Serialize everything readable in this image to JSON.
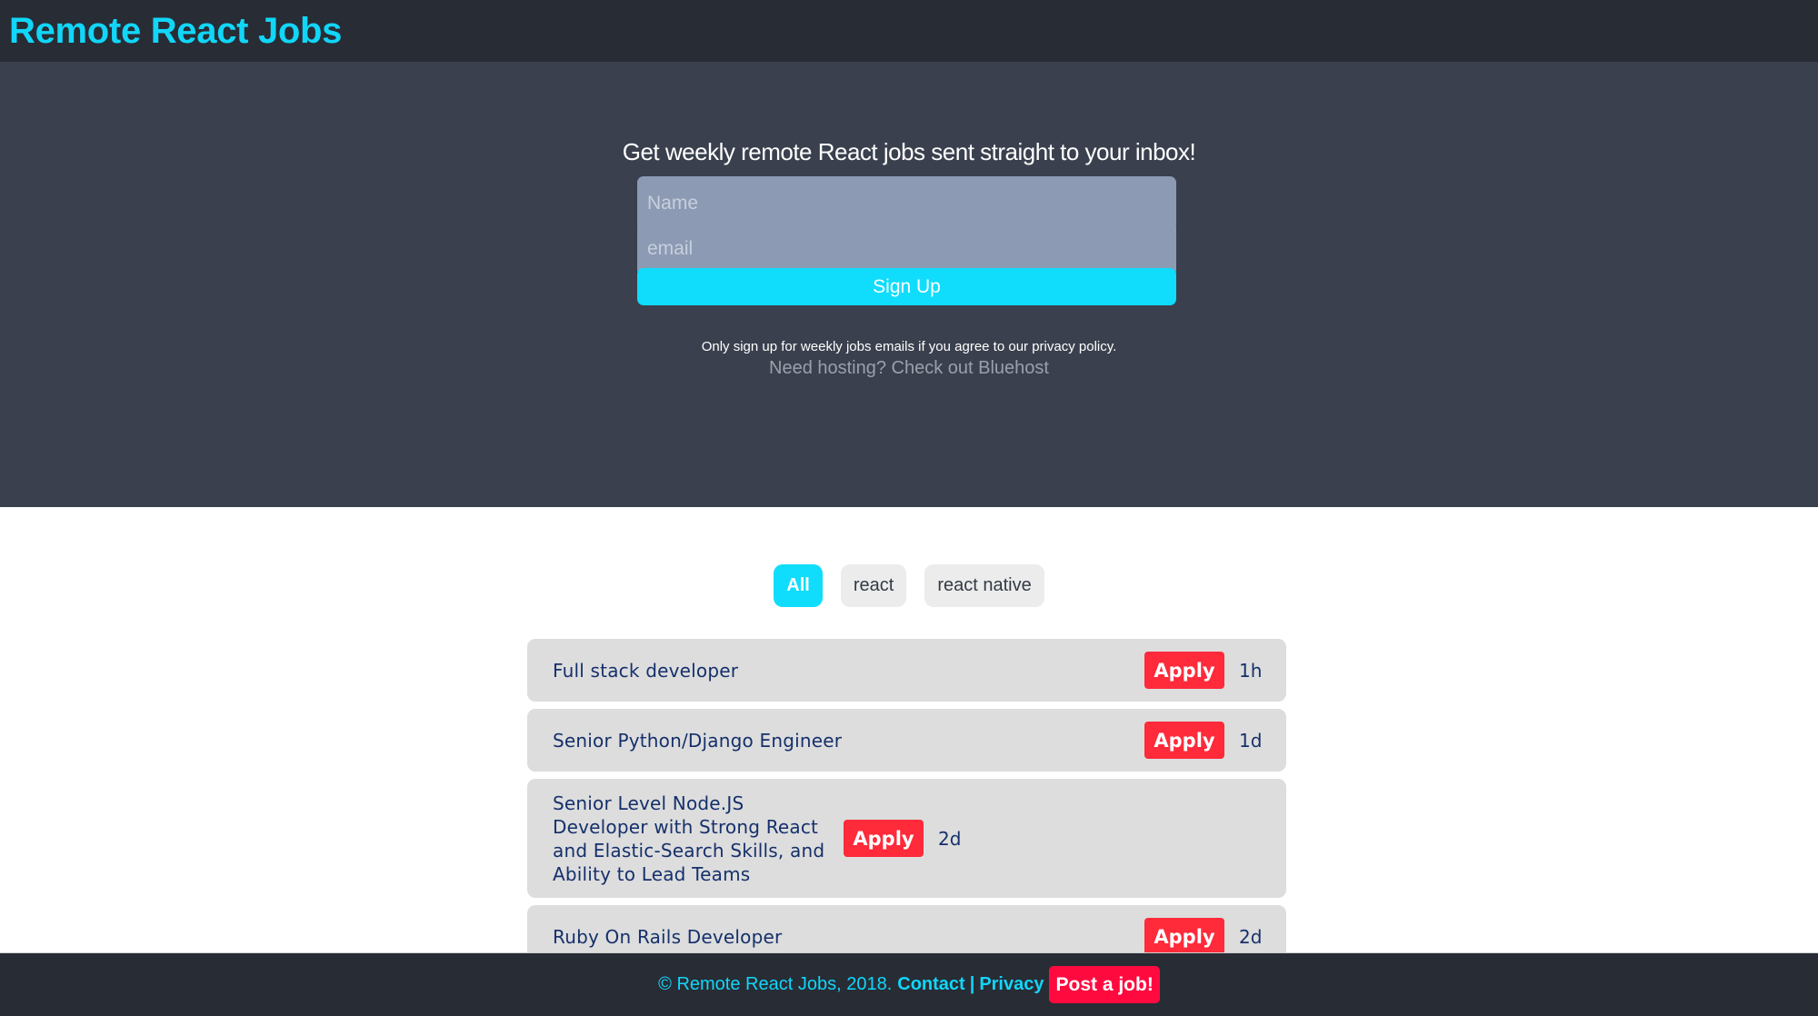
{
  "header": {
    "brand": "Remote React Jobs"
  },
  "hero": {
    "heading": "Get weekly remote React jobs sent straight to your inbox!",
    "name_field": {
      "placeholder": "Name",
      "value": ""
    },
    "email_field": {
      "placeholder": "email",
      "value": ""
    },
    "signup_label": "Sign Up",
    "privacy_note": "Only sign up for weekly jobs emails if you agree to our privacy policy.",
    "hosting_link": "Need hosting? Check out Bluehost"
  },
  "filters": [
    {
      "label": "All",
      "active": true
    },
    {
      "label": "react",
      "active": false
    },
    {
      "label": "react native",
      "active": false
    }
  ],
  "jobs": [
    {
      "title": "Full stack developer",
      "apply_label": "Apply",
      "age": "1h"
    },
    {
      "title": "Senior Python/Django Engineer",
      "apply_label": "Apply",
      "age": "1d"
    },
    {
      "title": "Senior Level Node.JS Developer with Strong React and Elastic-Search Skills, and Ability to Lead Teams",
      "apply_label": "Apply",
      "age": "2d"
    },
    {
      "title": "Ruby On Rails Developer",
      "apply_label": "Apply",
      "age": "2d"
    }
  ],
  "footer": {
    "copyright": "© Remote React Jobs, 2018.",
    "contact_label": "Contact",
    "separator": "|",
    "privacy_label": "Privacy",
    "post_job_label": "Post a job!"
  },
  "colors": {
    "accent": "#11d6f8",
    "header_bg": "#282c35",
    "hero_bg": "#3a404d",
    "apply_red": "#ff2a3a",
    "post_job_red": "#ff0a3f",
    "job_text": "#15306b",
    "card_bg": "#dddddd"
  }
}
